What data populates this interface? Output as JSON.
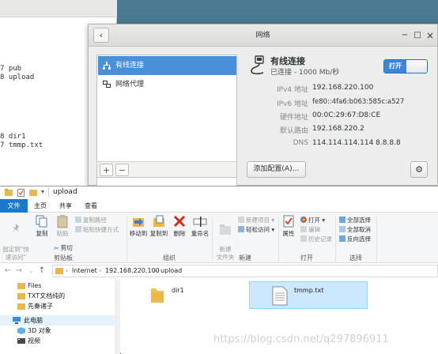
{
  "terminal": {
    "lines": [
      "7 pub",
      "8 upload",
      "8 dir1",
      "7 tmmp.txt"
    ]
  },
  "network": {
    "title": "网络",
    "back_icon": "chevron-left-icon",
    "controls": {
      "minimize": "−",
      "maximize": "□",
      "close": "×"
    },
    "sidebar": {
      "items": [
        {
          "label": "有线连接",
          "icon": "network-wired-icon",
          "selected": true
        },
        {
          "label": "网络代理",
          "icon": "network-proxy-icon",
          "selected": false
        }
      ],
      "add": "+",
      "remove": "−"
    },
    "wired": {
      "title": "有线连接",
      "status": "已连接 - 1000 Mb/秒",
      "toggle": "打开"
    },
    "details": [
      {
        "key": "IPv4 地址",
        "value": "192.168.220.100"
      },
      {
        "key": "IPv6 地址",
        "value": "fe80::4fa6:b063:585c:a527"
      },
      {
        "key": "硬件地址",
        "value": "00:0C:29:67:D8:CE"
      },
      {
        "key": "默认路由",
        "value": "192.168.220.2"
      },
      {
        "key": "DNS",
        "value": "114.114.114.114 8.8.8.8"
      }
    ],
    "add_config": "添加配置(A)…",
    "settings_icon": "gear-icon"
  },
  "explorer": {
    "title": "upload",
    "tabs": [
      "文件",
      "主页",
      "共享",
      "查看"
    ],
    "ribbon": {
      "pin_quick": "固定到\"快\n速访问\"",
      "copy": "复制",
      "paste": "粘贴",
      "copy_path": "复制路径",
      "paste_shortcut": "粘贴快捷方式",
      "cut": "剪切",
      "clipboard": "剪贴板",
      "move_to": "移动到",
      "copy_to": "复制到",
      "delete": "删除",
      "rename": "重命名",
      "organize": "组织",
      "new_folder": "新建\n文件夹",
      "new_item": "新建项目",
      "easy_access": "轻松访问",
      "new": "新建",
      "properties": "属性",
      "open": "打开",
      "edit": "编辑",
      "history": "历史记录",
      "open_group": "打开",
      "select_all": "全部选择",
      "select_none": "全部取消",
      "invert": "反向选择",
      "select": "选择"
    },
    "address": [
      "Internet",
      "192.168.220.100",
      "upload"
    ],
    "nav": [
      {
        "label": "Files",
        "icon": "folder-icon"
      },
      {
        "label": "TXT文档纯的",
        "icon": "folder-icon"
      },
      {
        "label": "先秦诸子",
        "icon": "folder-icon"
      },
      {
        "label": "此电脑",
        "icon": "computer-icon"
      },
      {
        "label": "3D 对象",
        "icon": "cube-icon"
      },
      {
        "label": "视频",
        "icon": "video-icon"
      }
    ],
    "files": [
      {
        "name": "dir1",
        "icon": "folder-icon"
      },
      {
        "name": "tmmp.txt",
        "icon": "text-file-icon"
      }
    ],
    "watermark": "https://blog.csdn.net/q297896911"
  }
}
